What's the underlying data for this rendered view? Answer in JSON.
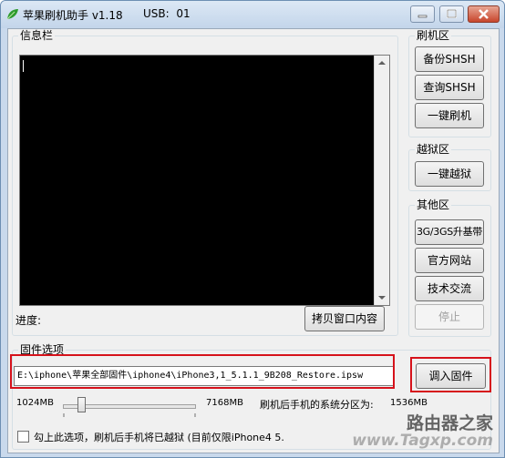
{
  "app": {
    "title": "苹果刷机助手 v1.18",
    "usb_label": "USB:",
    "usb_value": "01"
  },
  "info_panel": {
    "title": "信息栏",
    "progress_label": "进度:",
    "copy_button": "拷贝窗口内容"
  },
  "flash_group": {
    "title": "刷机区",
    "buttons": [
      "备份SHSH",
      "查询SHSH",
      "一键刷机"
    ]
  },
  "jailbreak_group": {
    "title": "越狱区",
    "buttons": [
      "一键越狱"
    ]
  },
  "other_group": {
    "title": "其他区",
    "buttons": [
      "3G/3GS升基带",
      "官方网站",
      "技术交流"
    ],
    "stop_button": "停止"
  },
  "firmware": {
    "title": "固件选项",
    "path": "E:\\iphone\\苹果全部固件\\iphone4\\iPhone3,1_5.1.1_9B208_Restore.ipsw",
    "load_button": "调入固件",
    "slider_min": "1024MB",
    "slider_max": "7168MB",
    "partition_label": "刷机后手机的系统分区为:",
    "partition_value": "1536MB",
    "jailbreak_checkbox_label": "勾上此选项，刷机后手机将已越狱 (目前仅限iPhone4 5.",
    "jailbreak_checked": false
  },
  "watermark": {
    "line1": "路由器之家",
    "line2": "www.Tagxp.com"
  },
  "colors": {
    "highlight": "#d6121b",
    "console_bg": "#000000",
    "titlebar": "#c9d9ec"
  }
}
